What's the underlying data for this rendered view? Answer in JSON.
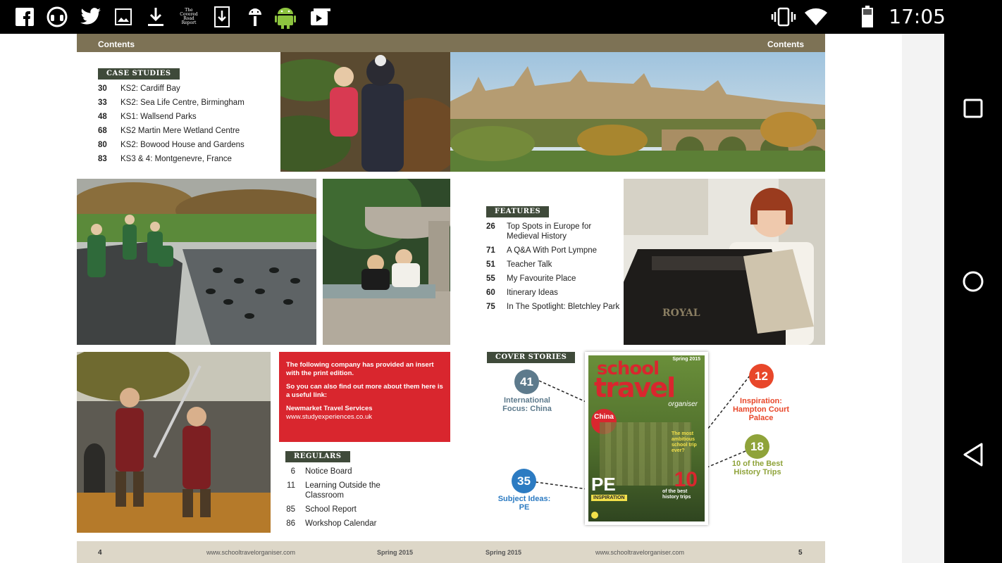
{
  "status_bar": {
    "time": "17:05",
    "icons": [
      "facebook-icon",
      "headset-icon",
      "twitter-icon",
      "image-icon",
      "download-icon",
      "covered-road-report-icon",
      "download-box-icon",
      "android-debug-icon",
      "android-icon",
      "media-share-icon",
      "vibrate-icon",
      "wifi-icon",
      "battery-icon"
    ],
    "covered_road_text": "The Covered Road Report"
  },
  "navigation": {
    "icons": [
      "recent-apps-icon",
      "home-icon",
      "back-icon"
    ]
  },
  "magazine": {
    "header_left": "Contents",
    "header_right": "Contents",
    "footer": {
      "page_left": "4",
      "url_left": "www.schooltravelorganiser.com",
      "issue_left": "Spring 2015",
      "issue_right": "Spring 2015",
      "url_right": "www.schooltravelorganiser.com",
      "page_right": "5"
    },
    "case_studies": {
      "label": "CASE STUDIES",
      "items": [
        {
          "num": "30",
          "title": "KS2: Cardiff Bay"
        },
        {
          "num": "33",
          "title": "KS2: Sea Life Centre, Birmingham"
        },
        {
          "num": "48",
          "title": "KS1: Wallsend Parks"
        },
        {
          "num": "68",
          "title": "KS2 Martin Mere Wetland Centre"
        },
        {
          "num": "80",
          "title": "KS2: Bowood House and Gardens"
        },
        {
          "num": "83",
          "title": "KS3 & 4: Montgenevre, France"
        }
      ]
    },
    "features": {
      "label": "FEATURES",
      "items": [
        {
          "num": "26",
          "title": "Top Spots in Europe for Medieval History"
        },
        {
          "num": "71",
          "title": "A Q&A With Port Lympne"
        },
        {
          "num": "51",
          "title": "Teacher Talk"
        },
        {
          "num": "55",
          "title": "My Favourite Place"
        },
        {
          "num": "60",
          "title": "Itinerary Ideas"
        },
        {
          "num": "75",
          "title": "In The Spotlight: Bletchley Park"
        }
      ]
    },
    "regulars": {
      "label": "REGULARS",
      "items": [
        {
          "num": "6",
          "title": "Notice Board"
        },
        {
          "num": "11",
          "title": "Learning Outside the Classroom"
        },
        {
          "num": "85",
          "title": "School Report"
        },
        {
          "num": "86",
          "title": "Workshop Calendar"
        }
      ]
    },
    "insert_notice": {
      "line1": "The following company has provided an insert with the print edition.",
      "line2": "So you can also find out more about them here is a useful link:",
      "company": "Newmarket Travel Services",
      "url": "www.studyexperiences.co.uk"
    },
    "cover_stories": {
      "label": "COVER STORIES",
      "items": [
        {
          "num": "41",
          "title": "International Focus: China",
          "color": "#5d7a8c"
        },
        {
          "num": "12",
          "title": "Inspiration: Hampton Court Palace",
          "color": "#e8472a"
        },
        {
          "num": "18",
          "title": "10 of the Best History Trips",
          "color": "#8fa33a"
        },
        {
          "num": "35",
          "title": "Subject Ideas: PE",
          "color": "#2c7bc2"
        }
      ]
    },
    "cover": {
      "season": "Spring 2015",
      "brand_top": "school",
      "brand_mid": "travel",
      "brand_bottom": "organiser",
      "china": "China",
      "pe": "PE",
      "pe_sub": "INSPIRATION",
      "ten": "10",
      "ten_sub": "of the best history trips",
      "ambitious": "The most ambitious school trip ever?"
    },
    "colors": {
      "header": "#7d7255",
      "footer": "#ddd7c8",
      "label_bg": "#3f4a3a",
      "red_box": "#d9262e"
    }
  }
}
